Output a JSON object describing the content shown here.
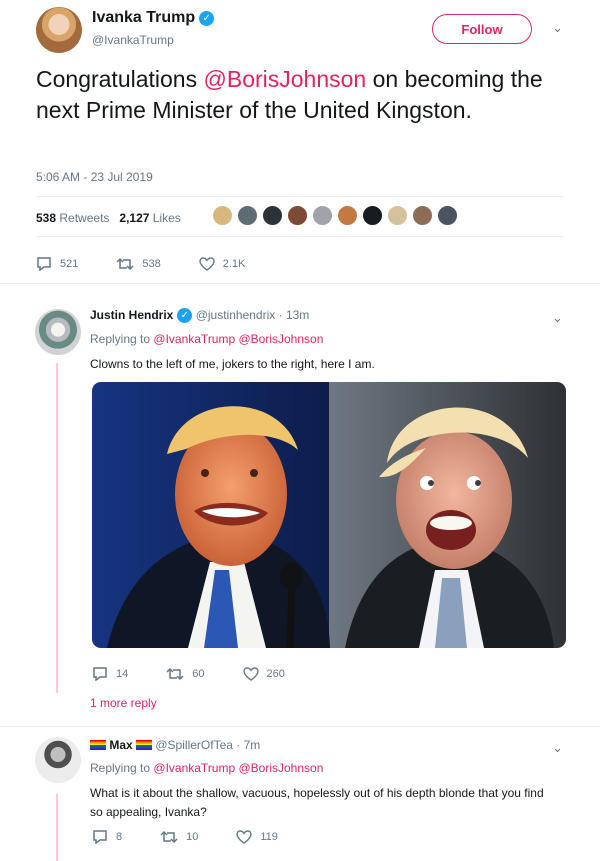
{
  "main_tweet": {
    "author_name": "Ivanka Trump",
    "handle": "@IvankaTrump",
    "follow_label": "Follow",
    "text_before": "Congratulations ",
    "mention": "@BorisJohnson",
    "text_after": " on becoming the next Prime Minister of the United Kingston.",
    "timestamp": "5:06 AM - 23 Jul 2019",
    "retweets_count": "538",
    "retweets_label": "Retweets",
    "likes_count": "2,127",
    "likes_label": "Likes",
    "reply_count": "521",
    "retweet_count": "538",
    "like_count": "2.1K"
  },
  "replies": [
    {
      "name": "Justin Hendrix",
      "handle": "@justinhendrix",
      "time": "13m",
      "replying_prefix": "Replying to",
      "replying_to": "@IvankaTrump @BorisJohnson",
      "text": "Clowns to the left of me, jokers to the right, here I am.",
      "reply_count": "14",
      "retweet_count": "60",
      "like_count": "260",
      "more_replies": "1 more reply"
    },
    {
      "name": "Max",
      "handle": "@SpillerOfTea",
      "time": "7m",
      "replying_prefix": "Replying to",
      "replying_to": "@IvankaTrump @BorisJohnson",
      "text": "What is it about the shallow, vacuous, hopelessly out of his depth blonde that you find so appealing, Ivanka?",
      "reply_count": "8",
      "retweet_count": "10",
      "like_count": "119"
    }
  ],
  "icons": {
    "reply": "reply-icon",
    "retweet": "retweet-icon",
    "like": "heart-icon",
    "verified": "verified-badge-icon",
    "more": "chevron-down-icon"
  },
  "colors": {
    "accent": "#e0245e",
    "verified": "#1da1f2",
    "muted": "#657786",
    "thread_line": "#ffcad7"
  }
}
